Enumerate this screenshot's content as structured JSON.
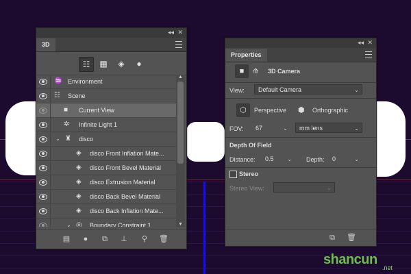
{
  "panel3d": {
    "tab": "3D",
    "layers": [
      {
        "name": "Environment",
        "icon": "environment-icon",
        "level": 0
      },
      {
        "name": "Scene",
        "icon": "scene-icon",
        "level": 0
      },
      {
        "name": "Current View",
        "icon": "camera-icon",
        "level": 1,
        "selected": true
      },
      {
        "name": "Infinite Light 1",
        "icon": "light-icon",
        "level": 1
      },
      {
        "name": "disco",
        "icon": "mesh-icon",
        "level": 1,
        "expanded": true
      },
      {
        "name": "disco Front Inflation Mate...",
        "icon": "material-icon",
        "level": 2
      },
      {
        "name": "disco Front Bevel Material",
        "icon": "material-icon",
        "level": 2
      },
      {
        "name": "disco Extrusion Material",
        "icon": "material-icon",
        "level": 2
      },
      {
        "name": "disco Back Bevel Material",
        "icon": "material-icon",
        "level": 2
      },
      {
        "name": "disco Back Inflation Mate...",
        "icon": "material-icon",
        "level": 2
      },
      {
        "name": "Boundary Constraint 1",
        "icon": "constraint-icon",
        "level": 2,
        "expanded": true
      }
    ]
  },
  "properties": {
    "tab": "Properties",
    "title": "3D Camera",
    "view_label": "View:",
    "view_value": "Default Camera",
    "perspective_label": "Perspective",
    "orthographic_label": "Orthographic",
    "fov_label": "FOV:",
    "fov_value": "67",
    "lens_value": "mm lens",
    "dof_heading": "Depth Of Field",
    "distance_label": "Distance:",
    "distance_value": "0.5",
    "depth_label": "Depth:",
    "depth_value": "0",
    "stereo_label": "Stereo",
    "stereo_view_label": "Stereo View:",
    "stereo_view_value": ""
  },
  "watermark": {
    "text": "shancun",
    "sub": ".net"
  }
}
